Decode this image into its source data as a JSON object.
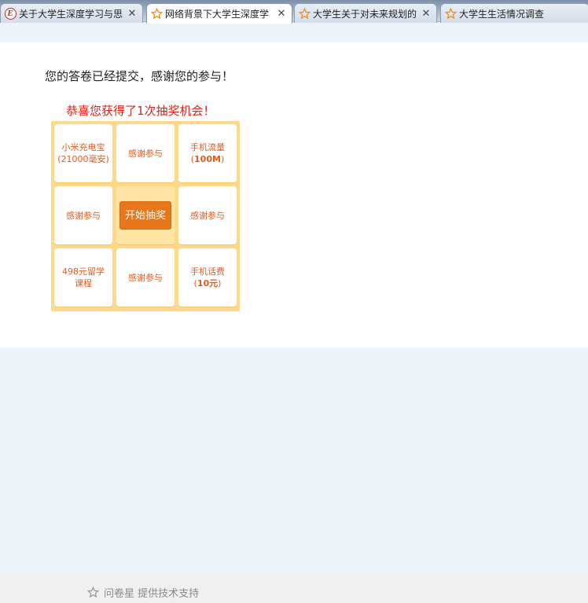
{
  "tabs": [
    {
      "title": "关于大学生深度学习与思",
      "icon": "e-logo-icon",
      "active": false
    },
    {
      "title": "网络背景下大学生深度学",
      "icon": "star-icon",
      "active": true
    },
    {
      "title": "大学生关于对未来规划的",
      "icon": "star-icon",
      "active": false
    },
    {
      "title": "大学生生活情况调查",
      "icon": "star-icon",
      "active": false
    }
  ],
  "tab_close": "✕",
  "e_logo_letter": "E",
  "main": {
    "thanks_message": "您的答卷已经提交，感谢您的参与！",
    "lottery_title": "恭喜您获得了1次抽奖机会！",
    "prizes": {
      "p1_line1": "小米充电宝",
      "p1_line2": "(21000毫安)",
      "p2": "感谢参与",
      "p3_line1": "手机流量",
      "p3_open": "(",
      "p3_bold": "100M",
      "p3_close": ")",
      "p4": "感谢参与",
      "p6": "感谢参与",
      "p7_line1": "498元留学",
      "p7_line2": "课程",
      "p8": "感谢参与",
      "p9_line1": "手机话费",
      "p9_open": "(",
      "p9_bold": "10元",
      "p9_close": ")"
    },
    "start_button": "开始抽奖"
  },
  "footer": {
    "brand": "问卷星",
    "support": " 提供技术支持"
  },
  "colors": {
    "accent_orange": "#e8761a",
    "prize_text": "#e35b1f",
    "title_red": "#d9261c",
    "board_bg": "#ffd98a",
    "page_bg": "#eef2f9"
  }
}
